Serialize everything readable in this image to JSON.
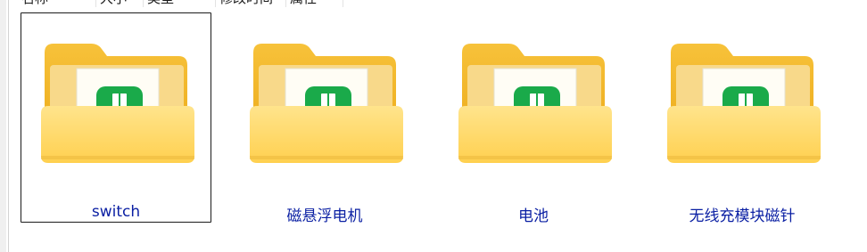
{
  "header": {
    "columns": [
      {
        "label": "名称"
      },
      {
        "label": "大小"
      },
      {
        "label": "类型"
      },
      {
        "label": "修改时间"
      },
      {
        "label": "属性"
      }
    ]
  },
  "files": [
    {
      "name": "switch",
      "selected": true,
      "icon": "folder-with-document-icon"
    },
    {
      "name": "磁悬浮电机",
      "selected": false,
      "icon": "folder-with-document-icon"
    },
    {
      "name": "电池",
      "selected": false,
      "icon": "folder-with-document-icon"
    },
    {
      "name": "无线充模块磁针",
      "selected": false,
      "icon": "folder-with-document-icon"
    }
  ],
  "colors": {
    "label": "#0a1fa3",
    "folder_back": "#f2b51f",
    "folder_front": "#ffd764",
    "doc_badge": "#1aaa4a"
  }
}
